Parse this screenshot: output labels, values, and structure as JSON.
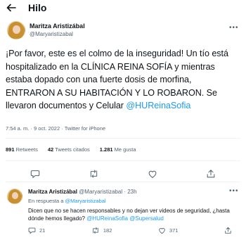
{
  "header": {
    "title": "Hilo"
  },
  "tweet": {
    "author_name": "Maritza Aristizábal",
    "author_handle": "@Maryaristizabal",
    "text": "¡Por favor, este es el colmo de la inseguridad! Un tío está hospitalizado en la CLÍNICA REINA SOFÍA y mientras estaba dopado con una fuerte dosis de morfina, ENTRARON A SU HABITACIÓN Y LO ROBARON. Se llevaron documentos y Celular",
    "mention": "@HUReinaSofia",
    "time": "7:54 a. m.",
    "date": "9 oct. 2022",
    "source": "Twitter for iPhone",
    "stats": {
      "retweets_count": "891",
      "retweets_label": "Retweets",
      "quotes_count": "42",
      "quotes_label": "Tweets citados",
      "likes_count": "1.281",
      "likes_label": "Me gusta"
    }
  },
  "reply": {
    "author_name": "Maritza Aristizábal",
    "author_handle": "@Maryaristizabal",
    "age": "23h",
    "reply_to_label": "En respuesta a",
    "reply_to_handle": "@Maryaristizabal",
    "text": "Dicen que no se hacen responsables y no dejan ver videos de seguridad, ¿hasta dónde hemos llegado?",
    "mention_1": "@HUReinaSofia",
    "mention_2": "@Supersalud",
    "replies": "21",
    "retweets": "182",
    "likes": "371"
  },
  "colors": {
    "accent": "#1d9bf0",
    "text": "#0f1419",
    "muted": "#536471",
    "divider": "#eff3f4"
  },
  "icons": [
    "back-arrow-icon",
    "more-icon",
    "reply-icon",
    "retweet-icon",
    "like-icon",
    "share-icon"
  ]
}
